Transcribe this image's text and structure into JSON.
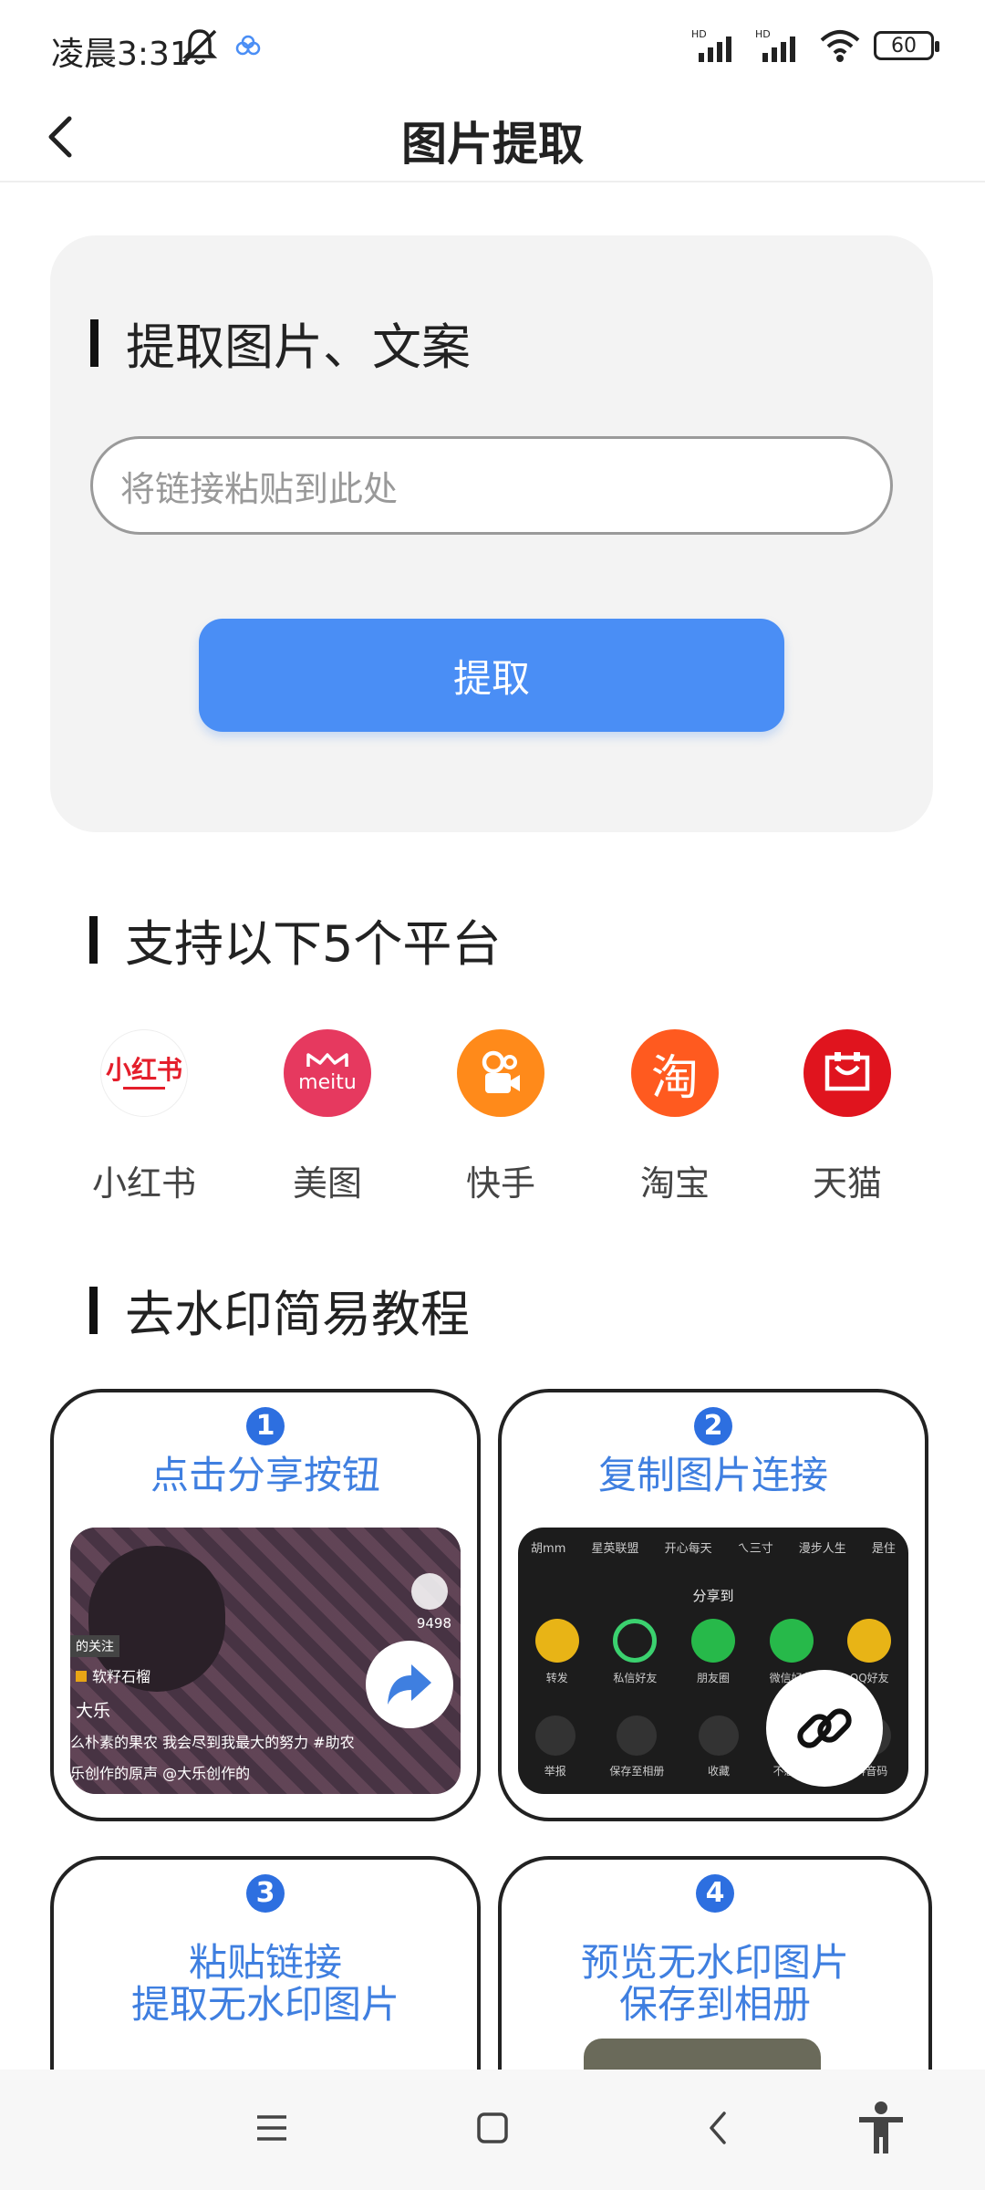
{
  "status": {
    "time": "凌晨3:31",
    "battery": "60"
  },
  "header": {
    "title": "图片提取"
  },
  "extract": {
    "section_title": "提取图片、文案",
    "placeholder": "将链接粘贴到此处",
    "button": "提取"
  },
  "platforms": {
    "section_title": "支持以下5个平台",
    "items": [
      {
        "label": "小红书",
        "color": "#ffffff",
        "logo_text": "小红书"
      },
      {
        "label": "美图",
        "color": "#e6395f",
        "logo_text": "meitu"
      },
      {
        "label": "快手",
        "color": "#ff8a1a",
        "logo_text": ""
      },
      {
        "label": "淘宝",
        "color": "#ff5a1f",
        "logo_text": "淘"
      },
      {
        "label": "天猫",
        "color": "#e0141e",
        "logo_text": ""
      }
    ]
  },
  "tutorial": {
    "section_title": "去水印简易教程",
    "steps": [
      {
        "num": "1",
        "title": "点击分享按钮"
      },
      {
        "num": "2",
        "title": "复制图片连接"
      },
      {
        "num": "3",
        "title": "粘贴链接",
        "title2": "提取无水印图片"
      },
      {
        "num": "4",
        "title": "预览无水印图片",
        "title2": "保存到相册"
      }
    ],
    "shot1": {
      "count": "9498",
      "tag": "的关注",
      "author": "软籽石榴",
      "user": "大乐",
      "caption": "么朴素的果农 我会尽到我最大的努力 #助农",
      "footer": "乐创作的原声   @大乐创作的"
    },
    "shot2": {
      "share_title": "分享到",
      "top_names": [
        "胡mm",
        "星英联盟",
        "开心每天",
        "ㄟ三寸",
        "漫步人生",
        "是住"
      ],
      "row1": [
        "转发",
        "私信好友",
        "朋友圈",
        "微信好友",
        "QQ好友"
      ],
      "row2": [
        "举报",
        "保存至相册",
        "收藏",
        "不感兴趣",
        "抖音码"
      ],
      "row1_colors": [
        "#e8b416",
        "#1d1d1d",
        "#27b94a",
        "#27b94a",
        "#e8b416"
      ]
    }
  },
  "bottom_nav": {
    "items": [
      "menu",
      "home",
      "back",
      "accessibility"
    ]
  }
}
